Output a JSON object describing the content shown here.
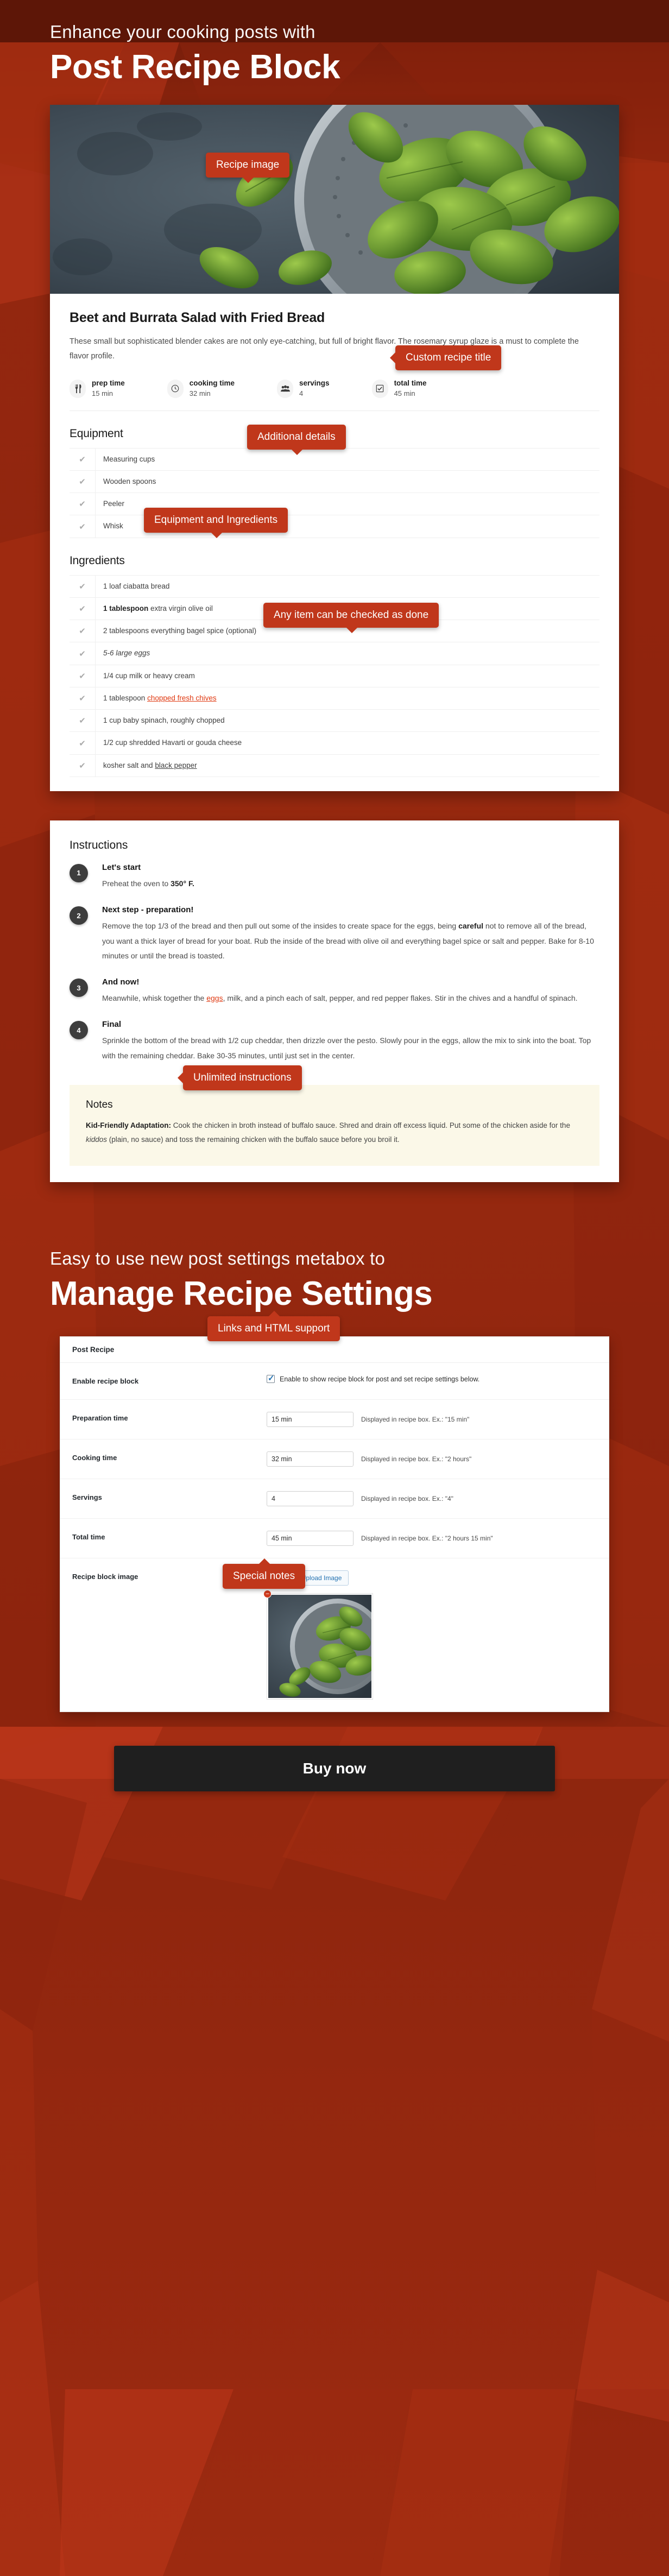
{
  "colors": {
    "brand_red": "#c0371b",
    "bg_dark_red": "#7d1d0c",
    "bg_mid_red": "#9e2a10",
    "notes_bg": "#fbf8e8",
    "link_red": "#e03a12",
    "buy_button_bg": "#1f1f1f",
    "step_badge": "#3d3d3d"
  },
  "hero_one": {
    "kicker": "Enhance your cooking posts with",
    "title": "Post Recipe Block"
  },
  "callouts": {
    "recipe_image": "Recipe image",
    "custom_title": "Custom recipe title",
    "additional_details": "Additional details",
    "equipment_ingredients": "Equipment and Ingredients",
    "checked_done": "Any item can be checked as done",
    "unlimited_instructions": "Unlimited instructions",
    "links_html": "Links and HTML support",
    "special_notes": "Special notes"
  },
  "recipe": {
    "title": "Beet and Burrata Salad with Fried Bread",
    "description": "These small but sophisticated blender cakes are not only eye-catching, but full of bright flavor. The rosemary syrup glaze is a must to complete the flavor profile.",
    "meta": [
      {
        "icon": "cutlery-icon",
        "label": "prep time",
        "value": "15 min"
      },
      {
        "icon": "clock-icon",
        "label": "cooking time",
        "value": "32 min"
      },
      {
        "icon": "people-icon",
        "label": "servings",
        "value": "4"
      },
      {
        "icon": "checkbox-icon",
        "label": "total time",
        "value": "45 min"
      }
    ],
    "equipment_heading": "Equipment",
    "equipment": [
      {
        "check": "✔",
        "text": "Measuring cups"
      },
      {
        "check": "✔",
        "text": "Wooden spoons"
      },
      {
        "check": "✔",
        "text": "Peeler"
      },
      {
        "check": "✔",
        "text": "Whisk"
      }
    ],
    "ingredients_heading": "Ingredients",
    "ingredients": [
      {
        "check": "✔",
        "html": "1 loaf ciabatta bread"
      },
      {
        "check": "✔",
        "html": "<b>1 tablespoon</b> extra virgin olive oil"
      },
      {
        "check": "✔",
        "html": "2 tablespoons everything bagel spice (optional)"
      },
      {
        "check": "✔",
        "html": "<i>5-6 large eggs</i>"
      },
      {
        "check": "✔",
        "html": "1/4 cup milk or heavy cream"
      },
      {
        "check": "✔",
        "html": "1 tablespoon <a class=\"red\">chopped fresh chives</a>"
      },
      {
        "check": "✔",
        "html": "1 cup baby spinach, roughly chopped"
      },
      {
        "check": "✔",
        "html": "1/2 cup shredded Havarti or gouda cheese"
      },
      {
        "check": "✔",
        "html": "kosher salt and <a class=\"dark\">black pepper</a>"
      }
    ]
  },
  "instructions": {
    "heading": "Instructions",
    "steps": [
      {
        "num": "1",
        "title": "Let's start",
        "html": "Preheat the oven to <b>350&deg; F.</b>"
      },
      {
        "num": "2",
        "title": "Next step - preparation!",
        "html": "Remove the top 1/3 of the bread and then pull out some of the insides to create space for the eggs, being <b>careful</b> not to remove all of the bread, you want a thick layer of bread for your boat. Rub the inside of the bread with olive oil and everything bagel spice or salt and pepper. Bake for 8-10 minutes or until the bread is toasted."
      },
      {
        "num": "3",
        "title": "And now!",
        "html": "Meanwhile, whisk together the <a class=\"red\">eggs</a>, milk, and a pinch each of salt, pepper, and red pepper flakes. Stir in the chives and a handful of spinach."
      },
      {
        "num": "4",
        "title": "Final",
        "html": "Sprinkle the bottom of the bread with 1/2 cup cheddar, then drizzle over the pesto. Slowly pour in the eggs, allow the mix to sink into the boat. Top with the remaining cheddar. Bake 30-35 minutes, until just set in the center."
      }
    ]
  },
  "notes": {
    "heading": "Notes",
    "html": "<b>Kid-Friendly Adaptation:</b> Cook the chicken in broth instead of buffalo sauce. Shred and drain off excess liquid. Put some of the chicken aside for the <i>kiddos</i> (plain, no sauce) and toss the remaining chicken with the buffalo sauce before you broil it."
  },
  "hero_two": {
    "kicker": "Easy to use new post settings metabox to",
    "title": "Manage Recipe Settings"
  },
  "metabox": {
    "panel_title": "Post Recipe",
    "rows": [
      {
        "label": "Enable recipe block",
        "type": "checkbox",
        "checked": true,
        "checkbox_label": "Enable to show recipe block for post and set recipe settings below."
      },
      {
        "label": "Preparation time",
        "type": "text",
        "value": "15 min",
        "hint": "Displayed in recipe box. Ex.: \"15 min\""
      },
      {
        "label": "Cooking time",
        "type": "text",
        "value": "32 min",
        "hint": "Displayed in recipe box. Ex.: \"2 hours\""
      },
      {
        "label": "Servings",
        "type": "text",
        "value": "4",
        "hint": "Displayed in recipe box. Ex.: \"4\""
      },
      {
        "label": "Total time",
        "type": "text",
        "value": "45 min",
        "hint": "Displayed in recipe box. Ex.: \"2 hours 15 min\""
      },
      {
        "label": "Recipe block image",
        "type": "image",
        "button_label": "Select or Upload Image",
        "remove_label": "−"
      }
    ]
  },
  "footer": {
    "buy_label": "Buy now"
  }
}
